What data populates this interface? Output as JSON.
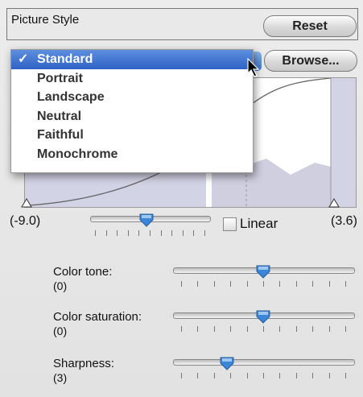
{
  "picture_style": {
    "label": "Picture Style",
    "reset_label": "Reset",
    "browse_label": "Browse...",
    "selected": "Standard",
    "options": [
      "Standard",
      "Portrait",
      "Landscape",
      "Neutral",
      "Faithful",
      "Monochrome"
    ],
    "check_mark": "✓"
  },
  "range": {
    "min_label": "(-9.0)",
    "max_label": "(3.6)",
    "linear_label": "Linear",
    "linear_checked": false,
    "slider_fraction": 0.47
  },
  "sliders": [
    {
      "label": "Color tone:",
      "value_label": "(0)",
      "fraction": 0.5
    },
    {
      "label": "Color saturation:",
      "value_label": "(0)",
      "fraction": 0.5
    },
    {
      "label": "Sharpness:",
      "value_label": "(3)",
      "fraction": 0.3
    }
  ],
  "colors": {
    "selection": "#2e62c4",
    "thumb": "#3b86d6",
    "curve_fill": "#c8c8de"
  }
}
